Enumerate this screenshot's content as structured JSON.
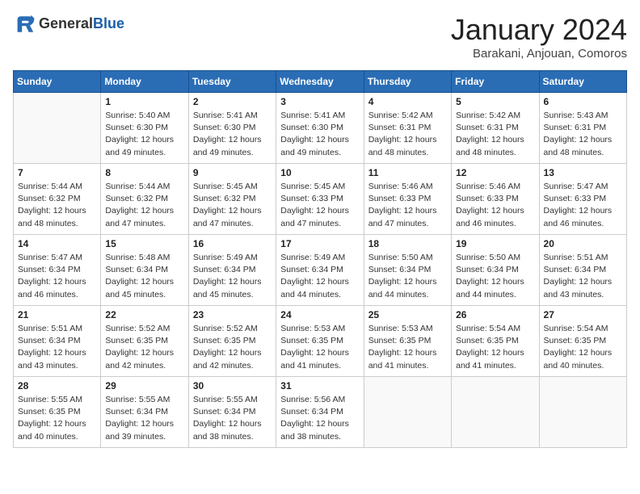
{
  "header": {
    "logo_general": "General",
    "logo_blue": "Blue",
    "month_title": "January 2024",
    "subtitle": "Barakani, Anjouan, Comoros"
  },
  "weekdays": [
    "Sunday",
    "Monday",
    "Tuesday",
    "Wednesday",
    "Thursday",
    "Friday",
    "Saturday"
  ],
  "weeks": [
    [
      {
        "day": "",
        "info": ""
      },
      {
        "day": "1",
        "info": "Sunrise: 5:40 AM\nSunset: 6:30 PM\nDaylight: 12 hours\nand 49 minutes."
      },
      {
        "day": "2",
        "info": "Sunrise: 5:41 AM\nSunset: 6:30 PM\nDaylight: 12 hours\nand 49 minutes."
      },
      {
        "day": "3",
        "info": "Sunrise: 5:41 AM\nSunset: 6:30 PM\nDaylight: 12 hours\nand 49 minutes."
      },
      {
        "day": "4",
        "info": "Sunrise: 5:42 AM\nSunset: 6:31 PM\nDaylight: 12 hours\nand 48 minutes."
      },
      {
        "day": "5",
        "info": "Sunrise: 5:42 AM\nSunset: 6:31 PM\nDaylight: 12 hours\nand 48 minutes."
      },
      {
        "day": "6",
        "info": "Sunrise: 5:43 AM\nSunset: 6:31 PM\nDaylight: 12 hours\nand 48 minutes."
      }
    ],
    [
      {
        "day": "7",
        "info": "Sunrise: 5:44 AM\nSunset: 6:32 PM\nDaylight: 12 hours\nand 48 minutes."
      },
      {
        "day": "8",
        "info": "Sunrise: 5:44 AM\nSunset: 6:32 PM\nDaylight: 12 hours\nand 47 minutes."
      },
      {
        "day": "9",
        "info": "Sunrise: 5:45 AM\nSunset: 6:32 PM\nDaylight: 12 hours\nand 47 minutes."
      },
      {
        "day": "10",
        "info": "Sunrise: 5:45 AM\nSunset: 6:33 PM\nDaylight: 12 hours\nand 47 minutes."
      },
      {
        "day": "11",
        "info": "Sunrise: 5:46 AM\nSunset: 6:33 PM\nDaylight: 12 hours\nand 47 minutes."
      },
      {
        "day": "12",
        "info": "Sunrise: 5:46 AM\nSunset: 6:33 PM\nDaylight: 12 hours\nand 46 minutes."
      },
      {
        "day": "13",
        "info": "Sunrise: 5:47 AM\nSunset: 6:33 PM\nDaylight: 12 hours\nand 46 minutes."
      }
    ],
    [
      {
        "day": "14",
        "info": "Sunrise: 5:47 AM\nSunset: 6:34 PM\nDaylight: 12 hours\nand 46 minutes."
      },
      {
        "day": "15",
        "info": "Sunrise: 5:48 AM\nSunset: 6:34 PM\nDaylight: 12 hours\nand 45 minutes."
      },
      {
        "day": "16",
        "info": "Sunrise: 5:49 AM\nSunset: 6:34 PM\nDaylight: 12 hours\nand 45 minutes."
      },
      {
        "day": "17",
        "info": "Sunrise: 5:49 AM\nSunset: 6:34 PM\nDaylight: 12 hours\nand 44 minutes."
      },
      {
        "day": "18",
        "info": "Sunrise: 5:50 AM\nSunset: 6:34 PM\nDaylight: 12 hours\nand 44 minutes."
      },
      {
        "day": "19",
        "info": "Sunrise: 5:50 AM\nSunset: 6:34 PM\nDaylight: 12 hours\nand 44 minutes."
      },
      {
        "day": "20",
        "info": "Sunrise: 5:51 AM\nSunset: 6:34 PM\nDaylight: 12 hours\nand 43 minutes."
      }
    ],
    [
      {
        "day": "21",
        "info": "Sunrise: 5:51 AM\nSunset: 6:34 PM\nDaylight: 12 hours\nand 43 minutes."
      },
      {
        "day": "22",
        "info": "Sunrise: 5:52 AM\nSunset: 6:35 PM\nDaylight: 12 hours\nand 42 minutes."
      },
      {
        "day": "23",
        "info": "Sunrise: 5:52 AM\nSunset: 6:35 PM\nDaylight: 12 hours\nand 42 minutes."
      },
      {
        "day": "24",
        "info": "Sunrise: 5:53 AM\nSunset: 6:35 PM\nDaylight: 12 hours\nand 41 minutes."
      },
      {
        "day": "25",
        "info": "Sunrise: 5:53 AM\nSunset: 6:35 PM\nDaylight: 12 hours\nand 41 minutes."
      },
      {
        "day": "26",
        "info": "Sunrise: 5:54 AM\nSunset: 6:35 PM\nDaylight: 12 hours\nand 41 minutes."
      },
      {
        "day": "27",
        "info": "Sunrise: 5:54 AM\nSunset: 6:35 PM\nDaylight: 12 hours\nand 40 minutes."
      }
    ],
    [
      {
        "day": "28",
        "info": "Sunrise: 5:55 AM\nSunset: 6:35 PM\nDaylight: 12 hours\nand 40 minutes."
      },
      {
        "day": "29",
        "info": "Sunrise: 5:55 AM\nSunset: 6:34 PM\nDaylight: 12 hours\nand 39 minutes."
      },
      {
        "day": "30",
        "info": "Sunrise: 5:55 AM\nSunset: 6:34 PM\nDaylight: 12 hours\nand 38 minutes."
      },
      {
        "day": "31",
        "info": "Sunrise: 5:56 AM\nSunset: 6:34 PM\nDaylight: 12 hours\nand 38 minutes."
      },
      {
        "day": "",
        "info": ""
      },
      {
        "day": "",
        "info": ""
      },
      {
        "day": "",
        "info": ""
      }
    ]
  ]
}
